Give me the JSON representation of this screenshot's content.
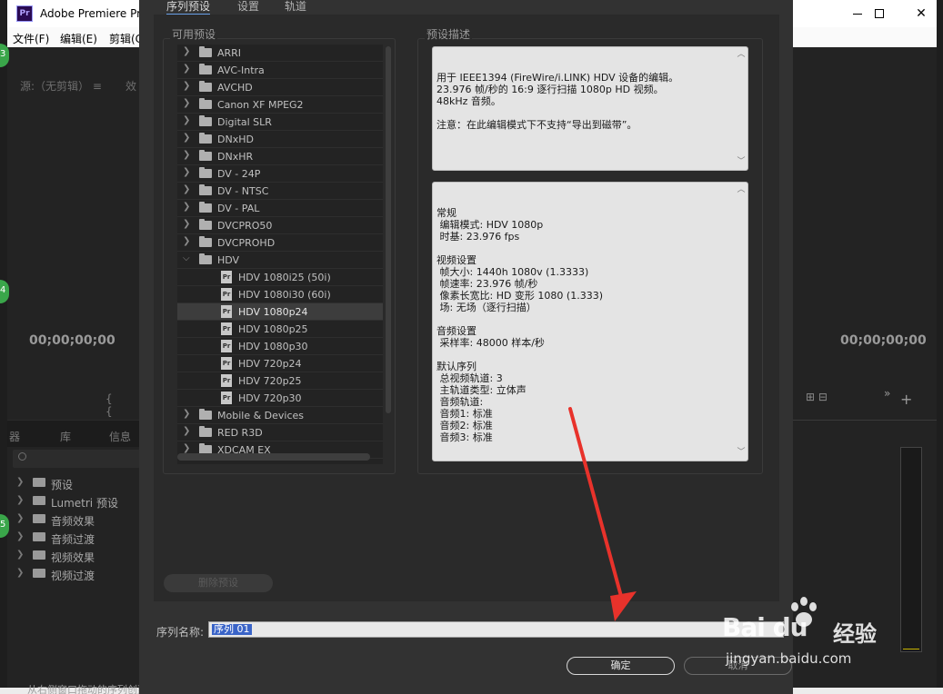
{
  "app": {
    "icon_text": "Pr",
    "title": "Adobe Premiere Pro",
    "menu": [
      "文件(F)",
      "编辑(E)",
      "剪辑(C"
    ]
  },
  "background": {
    "source_tab": "源:（无剪辑）",
    "source_tab_icon": "≡",
    "effects_tab": "效",
    "left_timecode": "00;00;00;00",
    "right_timecode": "00;00;00;00",
    "markers": "{ {",
    "panel_tabs": [
      "器",
      "库",
      "信息"
    ],
    "effects_items": [
      "预设",
      "Lumetri 预设",
      "音频效果",
      "音频过渡",
      "视频效果",
      "视频过渡"
    ],
    "green_markers": [
      "3",
      "4",
      "5"
    ],
    "bottom_hint": "从右侧窗口拖动的序列创建",
    "right_tools": "⊞ ⊟",
    "right_plus": "+",
    "right_more": "»"
  },
  "dialog": {
    "tabs": [
      "序列预设",
      "设置",
      "轨道"
    ],
    "active_tab": 0,
    "available_presets_label": "可用预设",
    "description_label": "预设描述",
    "tree": [
      {
        "label": "ARRI",
        "type": "folder",
        "expanded": false
      },
      {
        "label": "AVC-Intra",
        "type": "folder",
        "expanded": false
      },
      {
        "label": "AVCHD",
        "type": "folder",
        "expanded": false
      },
      {
        "label": "Canon XF MPEG2",
        "type": "folder",
        "expanded": false
      },
      {
        "label": "Digital SLR",
        "type": "folder",
        "expanded": false
      },
      {
        "label": "DNxHD",
        "type": "folder",
        "expanded": false
      },
      {
        "label": "DNxHR",
        "type": "folder",
        "expanded": false
      },
      {
        "label": "DV - 24P",
        "type": "folder",
        "expanded": false
      },
      {
        "label": "DV - NTSC",
        "type": "folder",
        "expanded": false
      },
      {
        "label": "DV - PAL",
        "type": "folder",
        "expanded": false
      },
      {
        "label": "DVCPRO50",
        "type": "folder",
        "expanded": false
      },
      {
        "label": "DVCPROHD",
        "type": "folder",
        "expanded": false
      },
      {
        "label": "HDV",
        "type": "folder",
        "expanded": true
      },
      {
        "label": "HDV 1080i25 (50i)",
        "type": "preset"
      },
      {
        "label": "HDV 1080i30 (60i)",
        "type": "preset"
      },
      {
        "label": "HDV 1080p24",
        "type": "preset",
        "selected": true
      },
      {
        "label": "HDV 1080p25",
        "type": "preset"
      },
      {
        "label": "HDV 1080p30",
        "type": "preset"
      },
      {
        "label": "HDV 720p24",
        "type": "preset"
      },
      {
        "label": "HDV 720p25",
        "type": "preset"
      },
      {
        "label": "HDV 720p30",
        "type": "preset"
      },
      {
        "label": "Mobile & Devices",
        "type": "folder",
        "expanded": false
      },
      {
        "label": "RED R3D",
        "type": "folder",
        "expanded": false
      },
      {
        "label": "XDCAM EX",
        "type": "folder",
        "expanded": false
      }
    ],
    "preset_icon_text": "Pr",
    "description_text": "用于 IEEE1394 (FireWire/i.LINK) HDV 设备的编辑。\n23.976 帧/秒的 16:9 逐行扫描 1080p HD 视频。\n48kHz 音频。\n\n注意：在此编辑模式下不支持“导出到磁带”。",
    "details_text": "常规\n 编辑模式: HDV 1080p\n 时基: 23.976 fps\n\n视频设置\n 帧大小: 1440h 1080v (1.3333)\n 帧速率: 23.976 帧/秒\n 像素长宽比: HD 变形 1080 (1.333)\n 场: 无场（逐行扫描）\n\n音频设置\n 采样率: 48000 样本/秒\n\n默认序列\n 总视频轨道: 3\n 主轨道类型: 立体声\n 音频轨道:\n 音频1: 标准\n 音频2: 标准\n 音频3: 标准",
    "delete_preset_label": "删除预设",
    "sequence_name_label": "序列名称:",
    "sequence_name_value": "序列 01",
    "ok_label": "确定",
    "cancel_label": "取消"
  },
  "watermark": {
    "brand": "Bai du",
    "cn": "经验",
    "url": "jingyan.baidu.com"
  },
  "colors": {
    "annotation_arrow": "#e8322b",
    "selection": "#3a64c8",
    "dialog_bg": "#323232"
  }
}
